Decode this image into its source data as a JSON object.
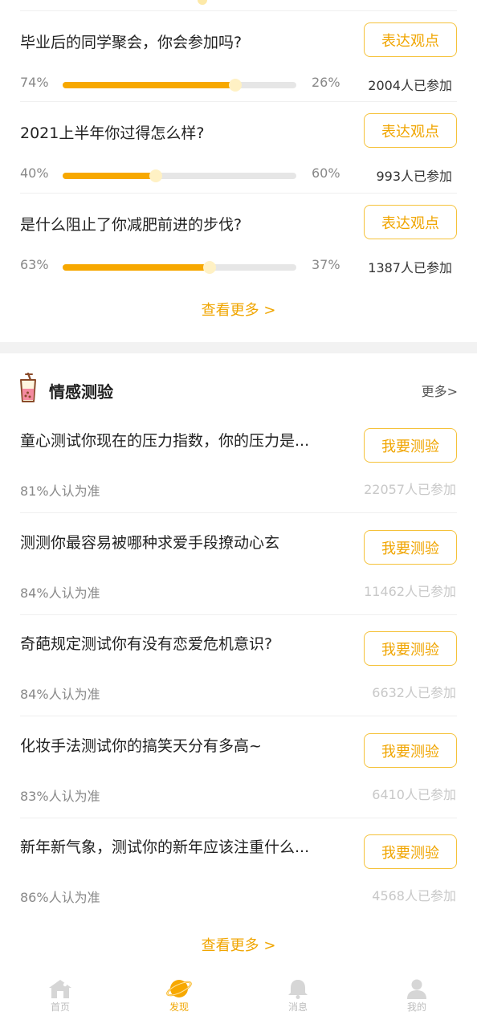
{
  "polls": [
    {
      "question": "毕业后的同学聚会，你会参加吗?",
      "button": "表达观点",
      "left_pct": "74%",
      "right_pct": "26%",
      "left_value": 0.74,
      "count": "2004人已参加"
    },
    {
      "question": "2021上半年你过得怎么样?",
      "button": "表达观点",
      "left_pct": "40%",
      "right_pct": "60%",
      "left_value": 0.4,
      "count": "993人已参加"
    },
    {
      "question": "是什么阻止了你减肥前进的步伐?",
      "button": "表达观点",
      "left_pct": "63%",
      "right_pct": "37%",
      "left_value": 0.63,
      "count": "1387人已参加"
    }
  ],
  "polls_more": "查看更多 >",
  "quiz_section": {
    "title": "情感测验",
    "more": "更多>",
    "items": [
      {
        "title": "童心测试你现在的压力指数，你的压力是...",
        "button": "我要测验",
        "accuracy": "81%人认为准",
        "count": "22057人已参加"
      },
      {
        "title": "测测你最容易被哪种求爱手段撩动心玄",
        "button": "我要测验",
        "accuracy": "84%人认为准",
        "count": "11462人已参加"
      },
      {
        "title": "奇葩规定测试你有没有恋爱危机意识?",
        "button": "我要测验",
        "accuracy": "84%人认为准",
        "count": "6632人已参加"
      },
      {
        "title": "化妆手法测试你的搞笑天分有多高~",
        "button": "我要测验",
        "accuracy": "83%人认为准",
        "count": "6410人已参加"
      },
      {
        "title": "新年新气象，测试你的新年应该注重什么...",
        "button": "我要测验",
        "accuracy": "86%人认为准",
        "count": "4568人已参加"
      }
    ],
    "more_link": "查看更多 >"
  },
  "tabbar": {
    "items": [
      {
        "label": "首页",
        "icon": "home-icon",
        "active": false
      },
      {
        "label": "发现",
        "icon": "planet-icon",
        "active": true
      },
      {
        "label": "消息",
        "icon": "bell-icon",
        "active": false
      },
      {
        "label": "我的",
        "icon": "user-icon",
        "active": false
      }
    ]
  },
  "colors": {
    "accent": "#f0a500",
    "bar_fill": "#f7a800",
    "bar_track": "#e6e6e6",
    "button_border": "#f5c23a"
  }
}
